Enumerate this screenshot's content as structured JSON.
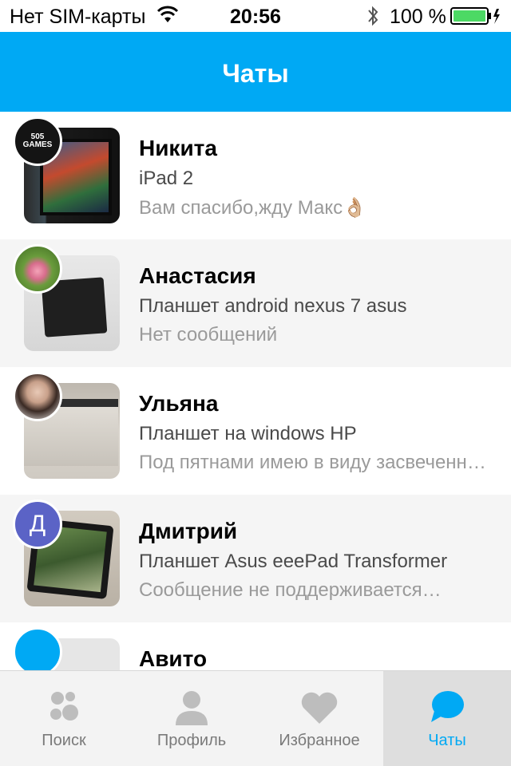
{
  "status_bar": {
    "carrier": "Нет SIM-карты",
    "time": "20:56",
    "battery_percent": "100 %",
    "icons": [
      "wifi-icon",
      "bluetooth-icon",
      "battery-icon",
      "charging-bolt-icon"
    ]
  },
  "header": {
    "title": "Чаты"
  },
  "chats": [
    {
      "name": "Никита",
      "subject": "iPad 2",
      "message": "Вам спасибо,жду Макс👌🏼",
      "avatar_text": "505 GAMES"
    },
    {
      "name": "Анастасия",
      "subject": "Планшет android nexus 7 asus",
      "message": "Нет сообщений"
    },
    {
      "name": "Ульяна",
      "subject": "Планшет на windows HP",
      "message": "Под пятнами имею в виду засвеченные…"
    },
    {
      "name": "Дмитрий",
      "subject": "Планшет Asus eeePad Transformer",
      "message": "Сообщение не поддерживается…",
      "avatar_letter": "Д"
    },
    {
      "name": "Авито",
      "subject": "",
      "message": ""
    }
  ],
  "tab_bar": {
    "tabs": [
      {
        "label": "Поиск",
        "icon": "search-dots-icon",
        "active": false
      },
      {
        "label": "Профиль",
        "icon": "profile-icon",
        "active": false
      },
      {
        "label": "Избранное",
        "icon": "heart-icon",
        "active": false
      },
      {
        "label": "Чаты",
        "icon": "chat-bubble-icon",
        "active": true
      }
    ]
  },
  "colors": {
    "accent": "#00a9f4",
    "inactive_tab": "#7a7a7a",
    "avatar_dmitriy": "#5b63c6"
  }
}
